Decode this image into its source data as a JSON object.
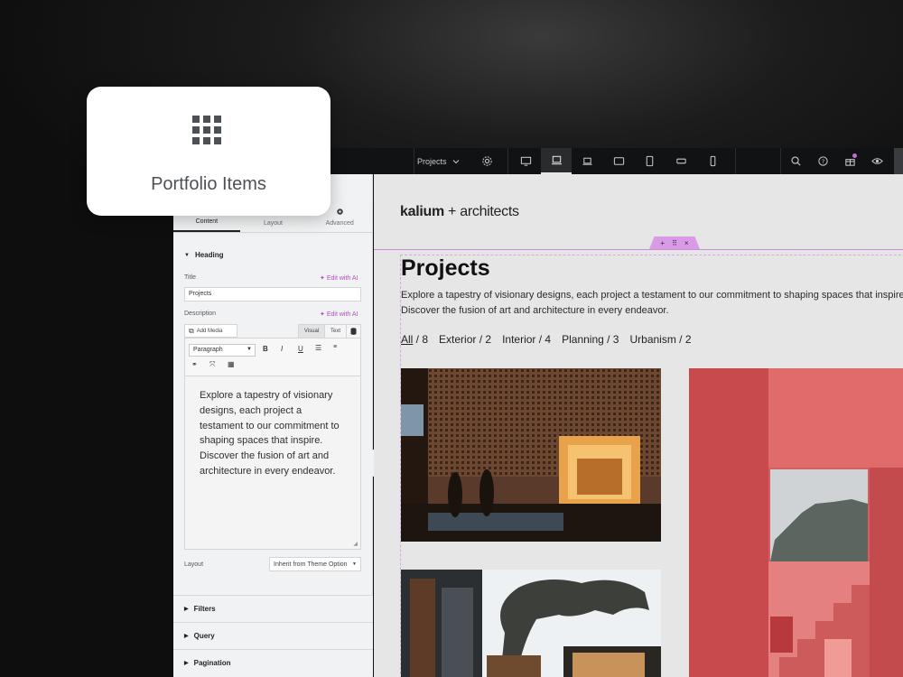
{
  "card": {
    "icon": "grid-icon",
    "label": "Portfolio Items"
  },
  "topbar": {
    "page_label": "Projects",
    "icons": [
      "settings-icon",
      "desktop-icon",
      "laptop-icon",
      "laptop-small-icon",
      "tablet-landscape-icon",
      "tablet-icon",
      "mobile-landscape-icon",
      "mobile-icon",
      "search-icon",
      "help-icon",
      "gift-icon",
      "preview-icon"
    ]
  },
  "panel": {
    "tabs": [
      {
        "label": "Content"
      },
      {
        "label": "Layout"
      },
      {
        "label": "Advanced"
      }
    ],
    "heading_section": "Heading",
    "title_label": "Title",
    "edit_ai": "Edit with AI",
    "title_value": "Projects",
    "description_label": "Description",
    "add_media": "Add Media",
    "visual_tab": "Visual",
    "text_tab": "Text",
    "paragraph": "Paragraph",
    "editor_text": "Explore a tapestry of visionary designs, each project a testament to our commitment to shaping spaces that inspire. Discover the fusion of art and architecture in every endeavor.",
    "layout_label": "Layout",
    "layout_value": "Inherit from Theme Option",
    "sections": [
      "Filters",
      "Query",
      "Pagination"
    ]
  },
  "canvas": {
    "logo_bold": "kalium",
    "logo_rest": "+ architects",
    "title": "Projects",
    "description_line1": "Explore a tapestry of visionary designs, each project a testament to our commitment to shaping spaces that inspire.",
    "description_line2": "Discover the fusion of art and architecture in every endeavor.",
    "filters": [
      {
        "label": "All",
        "count": " / 8"
      },
      {
        "label": "Exterior / 2",
        "count": ""
      },
      {
        "label": "Interior / 4",
        "count": ""
      },
      {
        "label": "Planning / 3",
        "count": ""
      },
      {
        "label": "Urbanism / 2",
        "count": ""
      }
    ]
  },
  "colors": {
    "accent": "#c36bd9",
    "panel_bg": "#f1f2f3",
    "canvas_bg": "#e6e6e6",
    "topbar_bg": "#111214"
  }
}
